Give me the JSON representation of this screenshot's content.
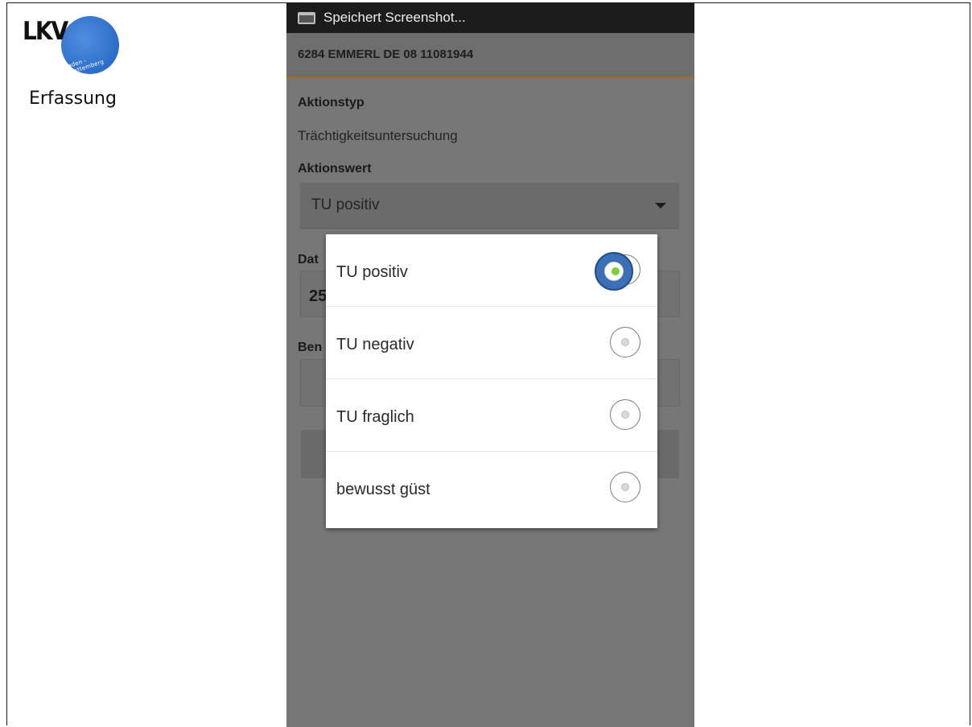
{
  "slide": {
    "logo_text": "LKV",
    "logo_ring_text": "Baden - Württemberg",
    "caption": "Erfassung"
  },
  "status_bar": {
    "icon": "screenshot-icon",
    "text": "Speichert Screenshot..."
  },
  "header": {
    "title": "6284 EMMERL DE 08 11081944"
  },
  "form": {
    "aktionstyp_label": "Aktionstyp",
    "aktionstyp_value": "Trächtigkeitsuntersuchung",
    "aktionswert_label": "Aktionswert",
    "aktionswert_selected": "TU positiv",
    "datum_label_fragment": "Dat",
    "datum_value_fragment": "25",
    "bemerkung_label_fragment": "Ben"
  },
  "dialog": {
    "options": [
      {
        "label": "TU positiv",
        "selected": true
      },
      {
        "label": "TU negativ",
        "selected": false
      },
      {
        "label": "TU fraglich",
        "selected": false
      },
      {
        "label": "bewusst güst",
        "selected": false
      }
    ]
  },
  "colors": {
    "brand_blue": "#3b6fb6",
    "accent_orange": "#a26a26",
    "overlay_gray": "#777777"
  }
}
